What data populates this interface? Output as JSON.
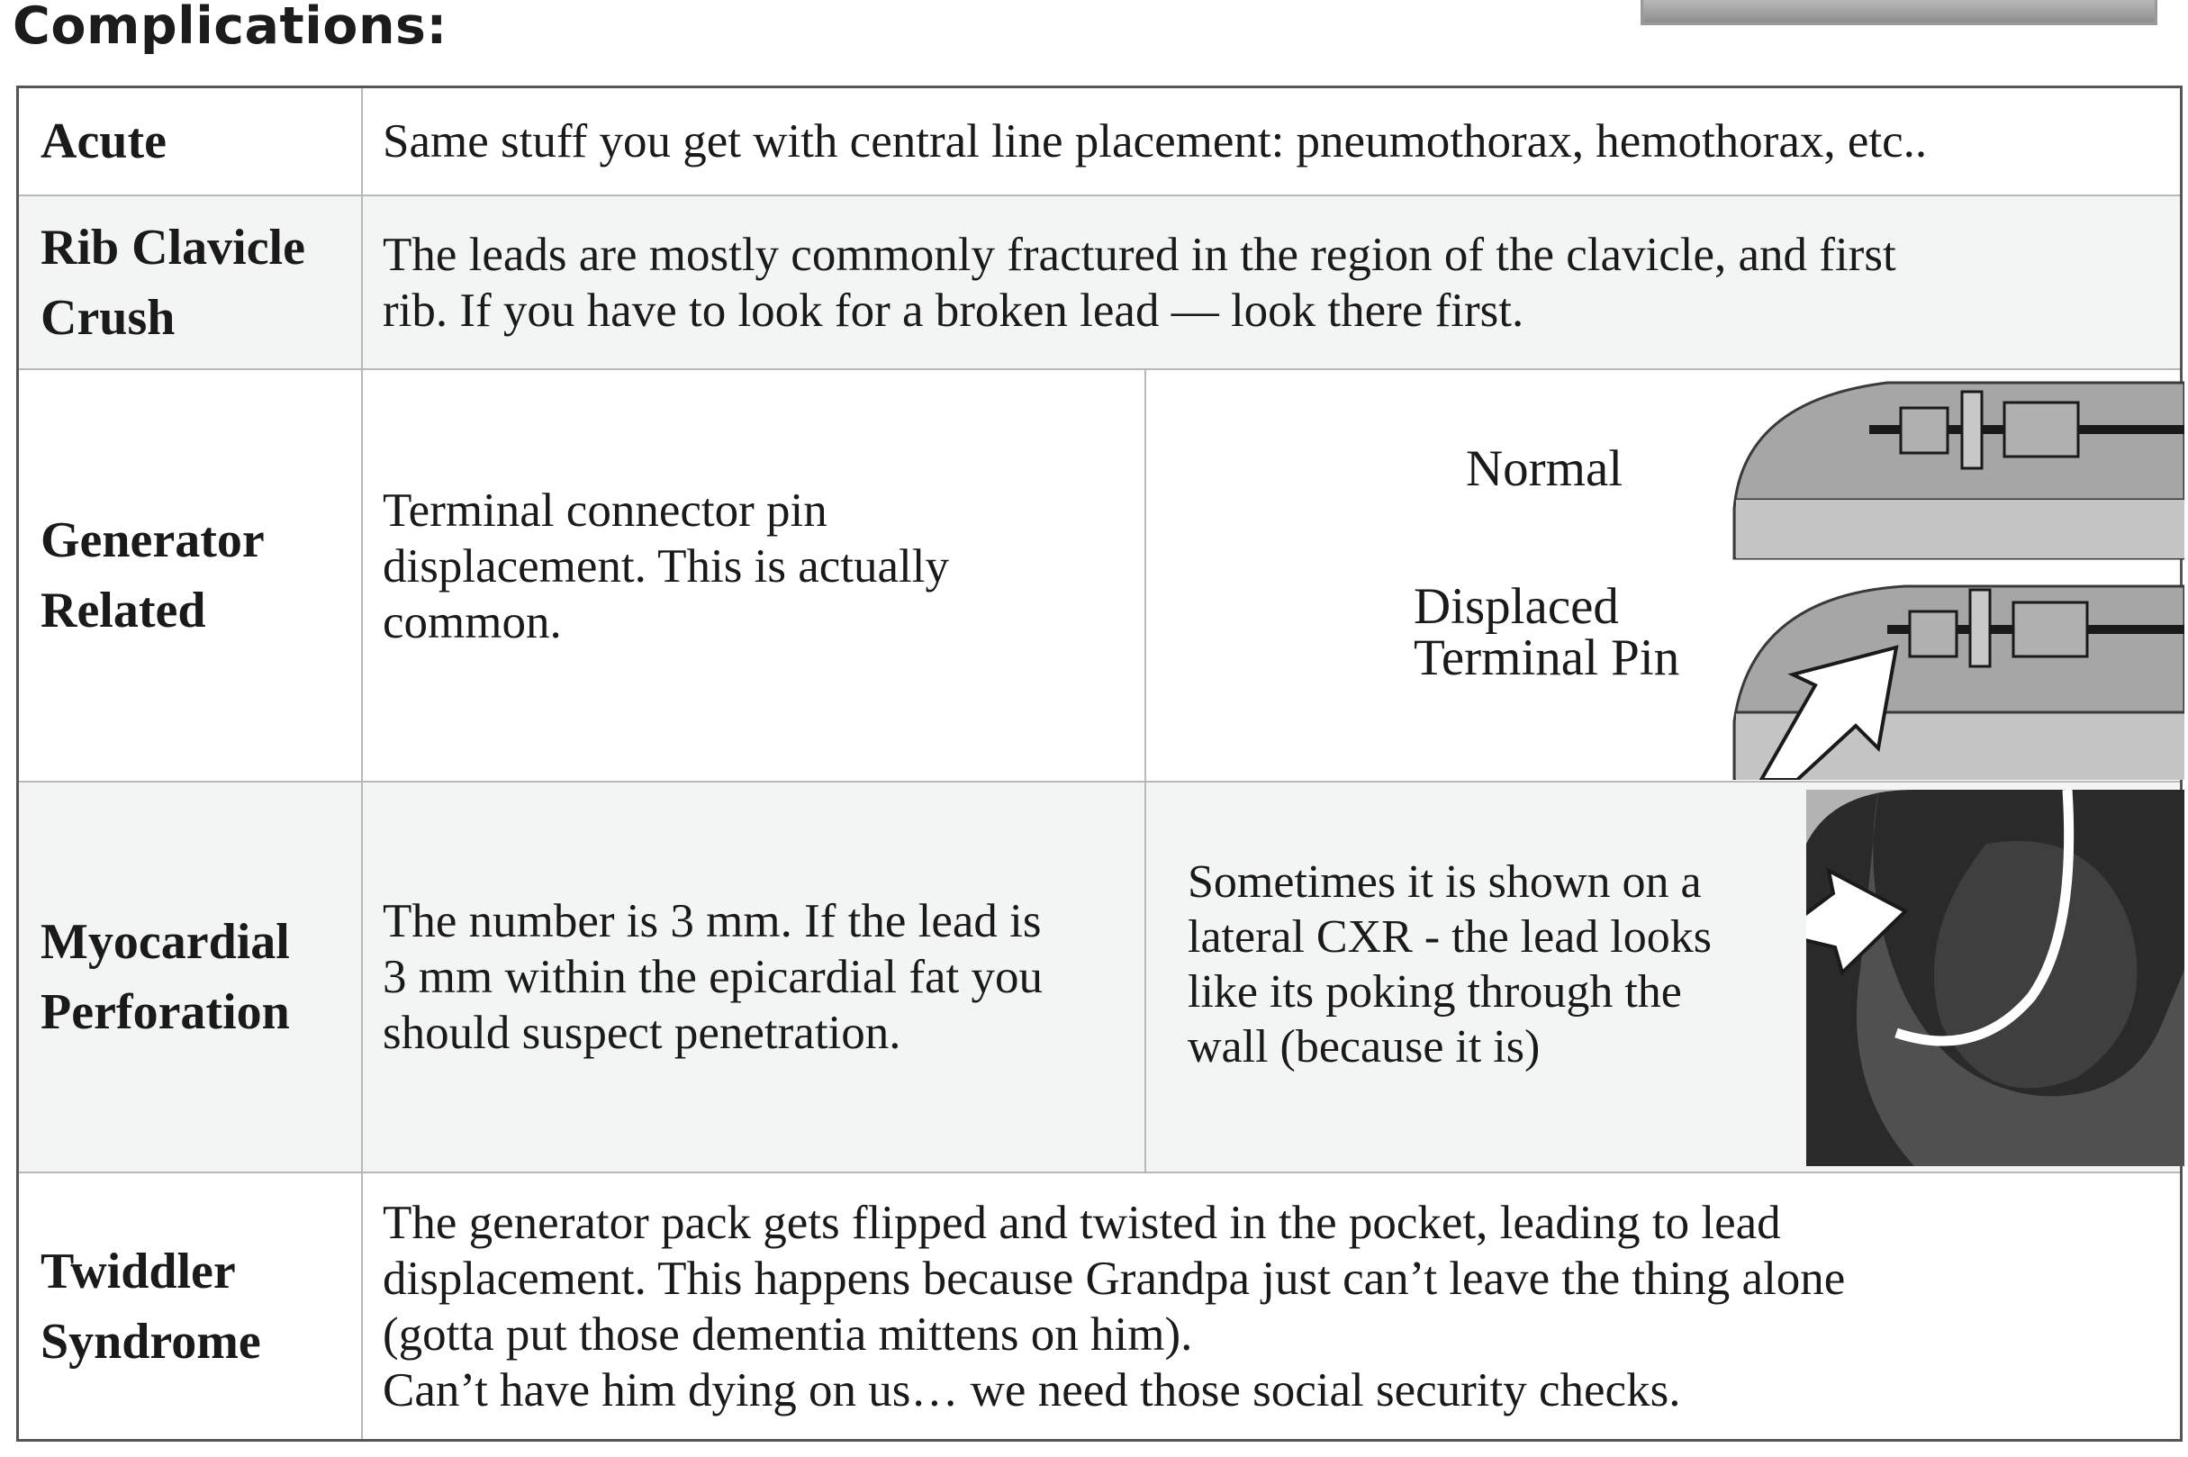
{
  "page": {
    "title": "Complications:"
  },
  "table": {
    "rows": [
      {
        "label": "Acute",
        "text": "Same stuff you get with central line placement:  pneumothorax, hemothorax, etc.."
      },
      {
        "label_line1": "Rib Clavicle",
        "label_line2": "Crush",
        "text": "The leads are mostly commonly fractured in the region of the clavicle, and first\nrib.  If you have to look for a broken lead — look there first."
      },
      {
        "label_line1": "Generator",
        "label_line2": "Related",
        "text": "Terminal connector pin\ndisplacement. This is actually\ncommon.",
        "figure": {
          "normal_label": "Normal",
          "displaced_label_line1": "Displaced",
          "displaced_label_line2": "Terminal Pin"
        }
      },
      {
        "label_line1": "Myocardial",
        "label_line2": "Perforation",
        "text": "The number is 3 mm.  If the lead is\n3 mm within the epicardial fat you\nshould suspect penetration.",
        "figure_text": "Sometimes it is shown on a\nlateral CXR - the lead looks\nlike its poking through the\nwall (because it is)"
      },
      {
        "label_line1": "Twiddler",
        "label_line2": "Syndrome",
        "text": "The generator pack gets flipped and twisted in the pocket, leading to lead\ndisplacement.  This happens because Grandpa just can’t leave the thing alone\n(gotta put those dementia mittens on him).\nCan’t have him dying on us… we need those social security checks."
      }
    ]
  },
  "colors": {
    "border": "#555555",
    "shade": "#f3f5f5",
    "figure_gray": "#9a9a9a",
    "figure_dark": "#3a3a3a"
  }
}
